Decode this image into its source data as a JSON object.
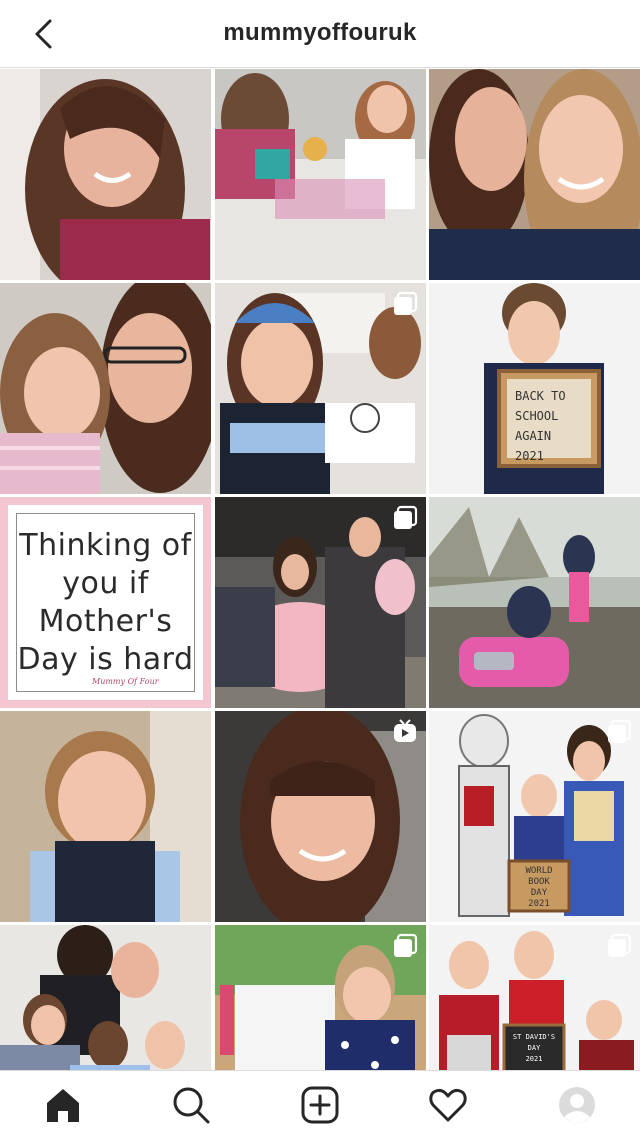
{
  "header": {
    "back_icon": "chevron-left-icon",
    "title": "mummyoffouruk"
  },
  "posts": [
    {
      "id": "post-1",
      "type": "photo"
    },
    {
      "id": "post-2",
      "type": "photo"
    },
    {
      "id": "post-3",
      "type": "photo"
    },
    {
      "id": "post-4",
      "type": "photo"
    },
    {
      "id": "post-5",
      "type": "carousel"
    },
    {
      "id": "post-6",
      "type": "photo",
      "sign_text": "BACK TO\nSCHOOL\nAGAIN\n2021"
    },
    {
      "id": "post-7",
      "type": "photo",
      "quote_text": "Thinking of\nyou if\nMother's\nDay is hard",
      "logo_text": "Mummy Of Four"
    },
    {
      "id": "post-8",
      "type": "carousel"
    },
    {
      "id": "post-9",
      "type": "photo"
    },
    {
      "id": "post-10",
      "type": "photo"
    },
    {
      "id": "post-11",
      "type": "reel"
    },
    {
      "id": "post-12",
      "type": "carousel",
      "book_text": "WORLD\nBOOK\nDAY\n2021"
    },
    {
      "id": "post-13",
      "type": "photo"
    },
    {
      "id": "post-14",
      "type": "carousel"
    },
    {
      "id": "post-15",
      "type": "carousel",
      "sign_text": "ST DAVID'S\nDAY\n2021"
    }
  ],
  "navbar": {
    "items": [
      "home-icon",
      "search-icon",
      "new-post-icon",
      "activity-heart-icon",
      "profile-avatar"
    ]
  },
  "colors": {
    "accent": "#262626",
    "divider": "#dbdbdb",
    "quote_border": "#f4c6d0"
  }
}
